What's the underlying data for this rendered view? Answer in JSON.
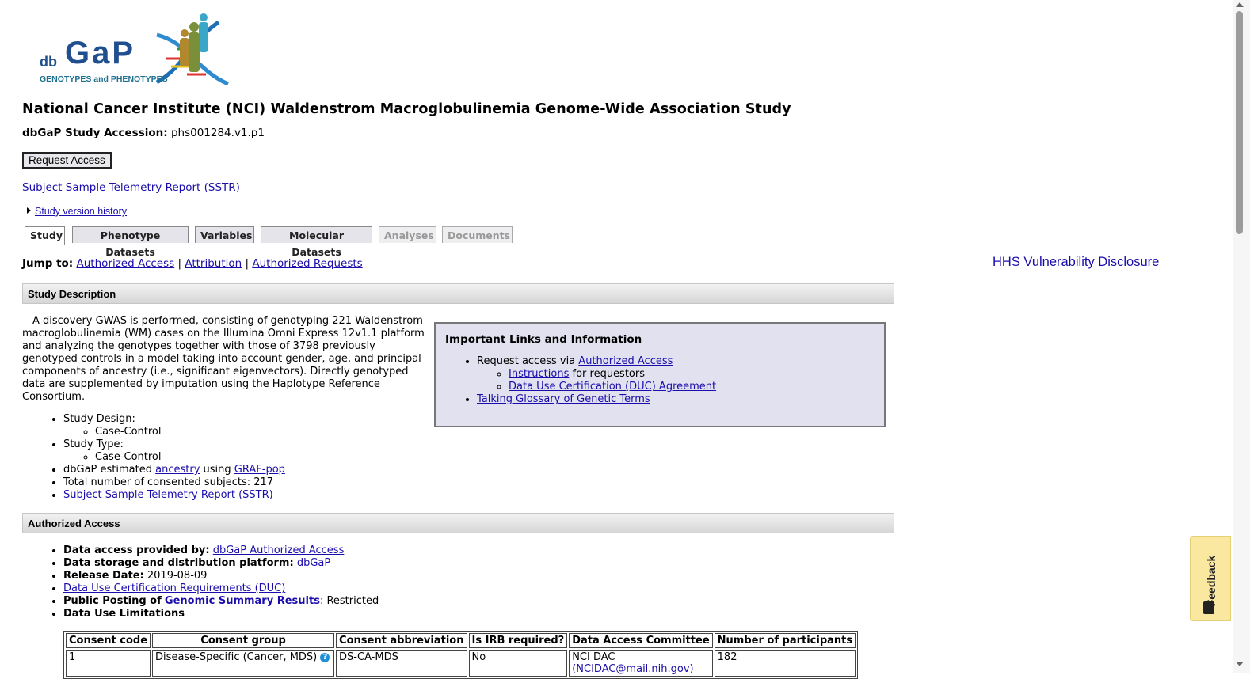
{
  "logo": {
    "prefix": "db",
    "name": "GaP",
    "tagline": "GENOTYPES and PHENOTYPES"
  },
  "study": {
    "title": "National Cancer Institute (NCI) Waldenstrom Macroglobulinemia Genome-Wide Association Study",
    "accession_label": "dbGaP Study Accession:",
    "accession": "phs001284.v1.p1"
  },
  "request_access_label": "Request Access",
  "sstr_link": "Subject Sample Telemetry Report (SSTR)",
  "version_history": "Study version history",
  "tabs": [
    {
      "label": "Study",
      "active": true
    },
    {
      "label": "Phenotype Datasets"
    },
    {
      "label": "Variables"
    },
    {
      "label": "Molecular Datasets"
    },
    {
      "label": "Analyses",
      "disabled": true
    },
    {
      "label": "Documents",
      "disabled": true
    }
  ],
  "jump": {
    "label": "Jump to:",
    "links": [
      "Authorized Access",
      "Attribution",
      "Authorized Requests"
    ],
    "sep": "|"
  },
  "hhs_link": "HHS Vulnerability Disclosure",
  "sections": {
    "description": "Study Description",
    "authorized": "Authorized Access"
  },
  "description": "A discovery GWAS is performed, consisting of genotyping 221 Waldenstrom macroglobulinemia (WM) cases on the Illumina Omni Express 12v1.1 platform and analyzing the genotypes together with those of 3798 previously genotyped controls in a model taking into account gender, age, and principal components of ancestry (i.e., significant eigenvectors). Directly genotyped data are supplemented by imputation using the Haplotype Reference Consortium.",
  "study_list": {
    "design_label": "Study Design:",
    "design": "Case-Control",
    "type_label": "Study Type:",
    "type": "Case-Control",
    "ancestry_pre": "dbGaP estimated",
    "ancestry_link": "ancestry",
    "ancestry_mid": "using",
    "graf_link": "GRAF-pop",
    "subjects": "Total number of consented subjects: 217",
    "sstr": "Subject Sample Telemetry Report (SSTR)"
  },
  "info_box": {
    "title": "Important Links and Information",
    "request_pre": "Request access via",
    "request_link": "Authorized Access",
    "instructions_link": "Instructions",
    "instructions_post": "for requestors",
    "duc_link": "Data Use Certification (DUC) Agreement",
    "glossary_link": "Talking Glossary of Genetic Terms"
  },
  "auth": {
    "provided_label": "Data access provided by:",
    "provided_link": "dbGaP Authorized Access",
    "platform_label": "Data storage and distribution platform:",
    "platform_link": "dbGaP",
    "release_label": "Release Date:",
    "release_date": "2019-08-09",
    "duc_req_link": "Data Use Certification Requirements (DUC)",
    "gsr_pre": "Public Posting of",
    "gsr_link": "Genomic Summary Results",
    "gsr_value": ": Restricted",
    "limitations": "Data Use Limitations"
  },
  "consent_table": {
    "headers": [
      "Consent code",
      "Consent group",
      "Consent abbreviation",
      "Is IRB required?",
      "Data Access Committee",
      "Number of participants"
    ],
    "row": [
      "1",
      "Disease-Specific (Cancer, MDS)",
      "DS-CA-MDS",
      "No",
      "NCI DAC",
      "182"
    ],
    "dac_email": "(NCIDAC@mail.nih.gov)"
  },
  "feedback_label": "Feedback",
  "colors": {
    "link": "#1a0dab",
    "info_bg": "#e1e1ef",
    "feedback_bg": "#fbe8a0"
  }
}
